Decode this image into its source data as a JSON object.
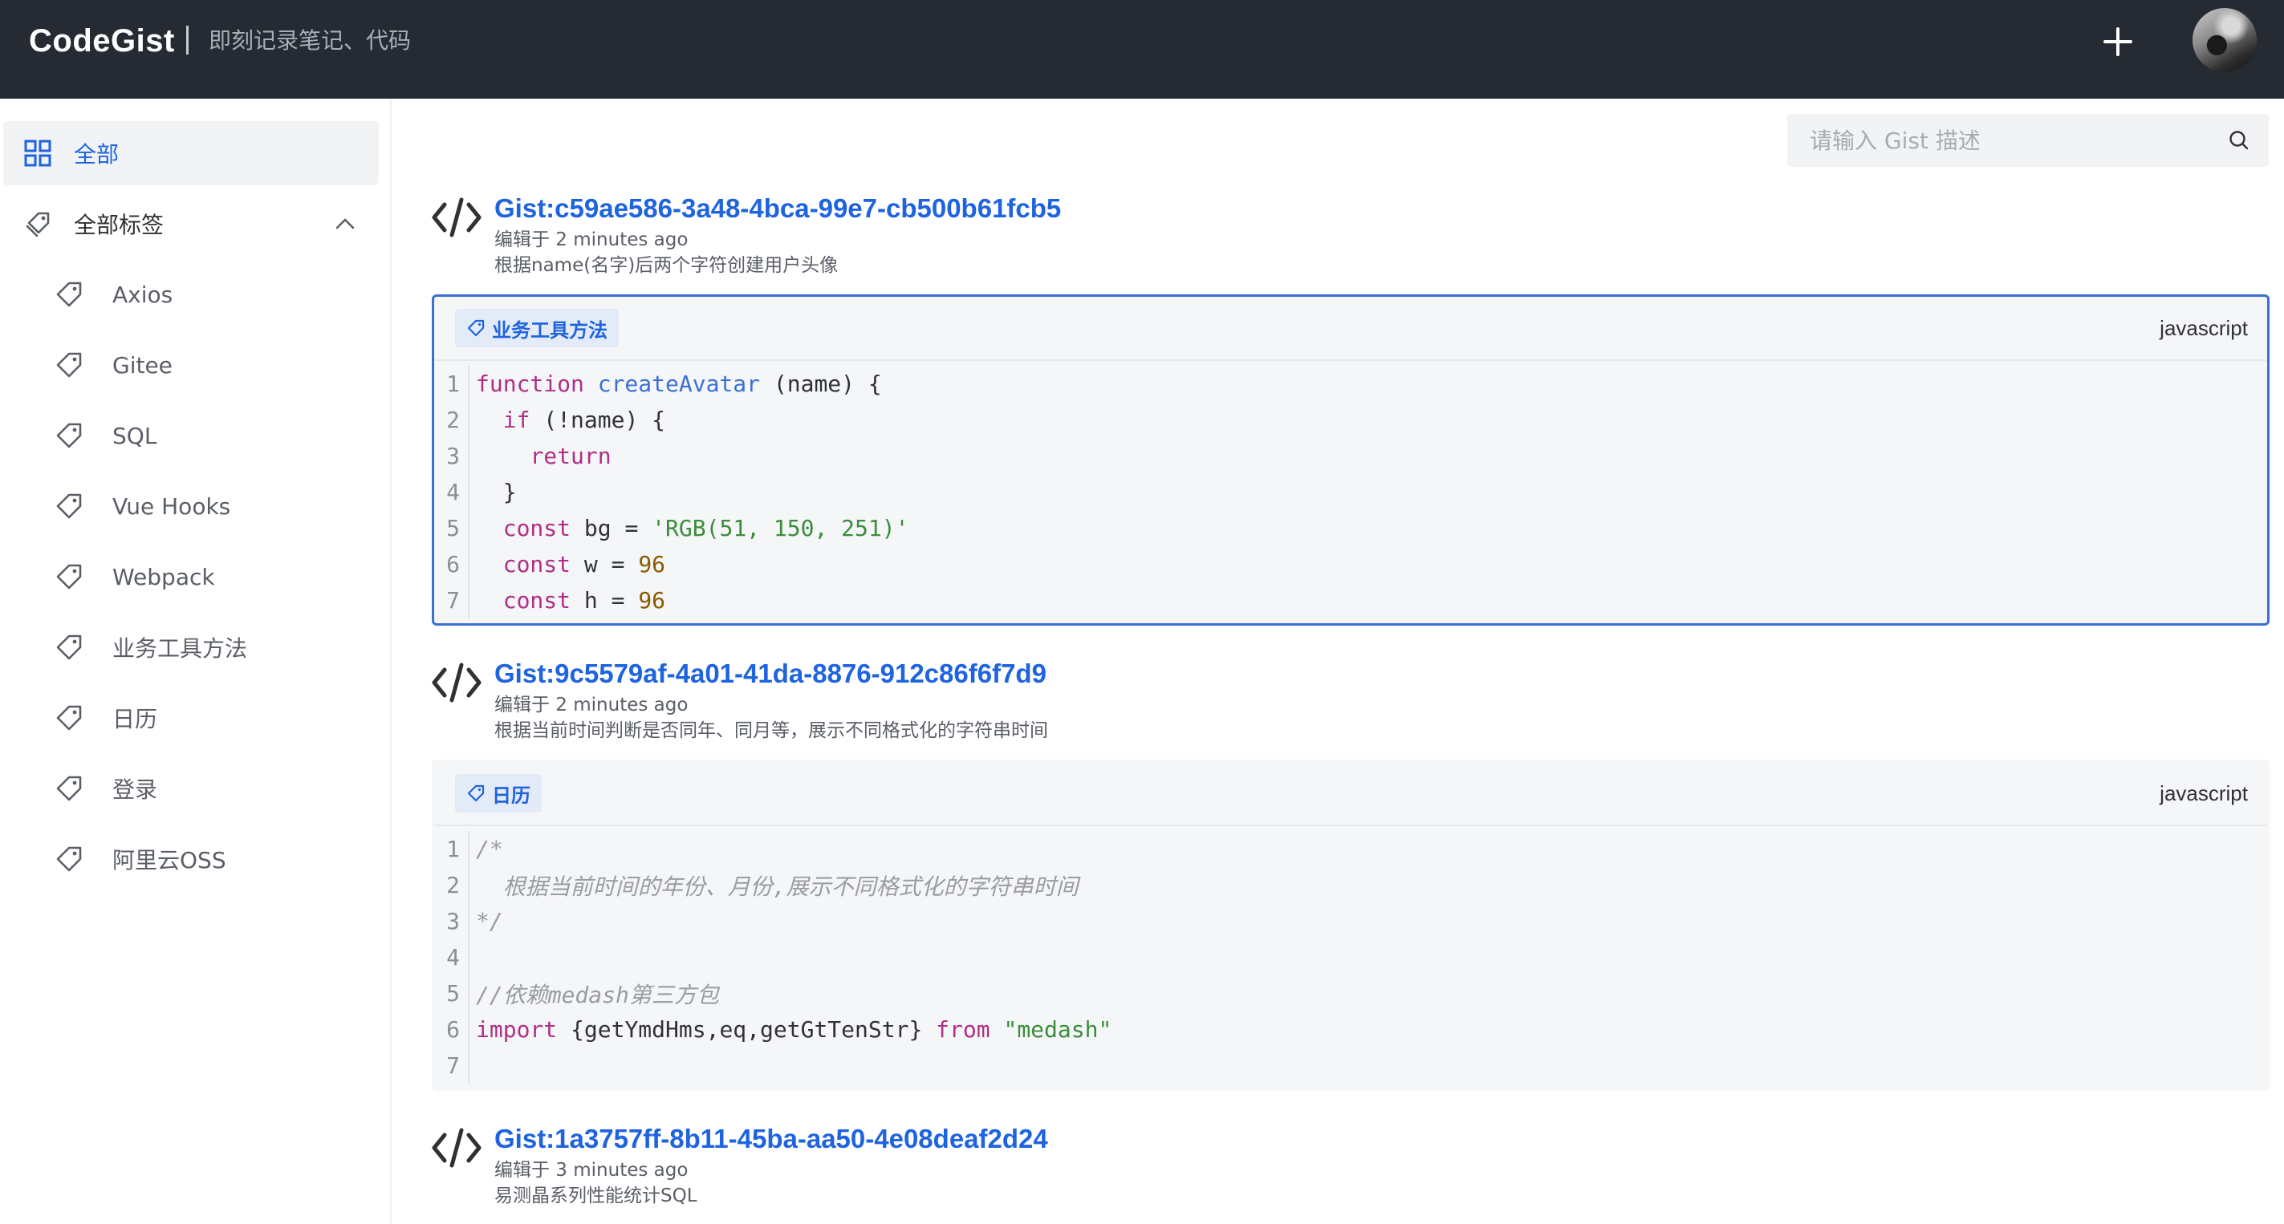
{
  "header": {
    "brand": "CodeGist",
    "subtitle": "即刻记录笔记、代码"
  },
  "sidebar": {
    "all_label": "全部",
    "tags_label": "全部标签",
    "tags": [
      "Axios",
      "Gitee",
      "SQL",
      "Vue Hooks",
      "Webpack",
      "业务工具方法",
      "日历",
      "登录",
      "阿里云OSS"
    ]
  },
  "search": {
    "placeholder": "请输入 Gist 描述"
  },
  "gists": [
    {
      "title": "Gist:c59ae586-3a48-4bca-99e7-cb500b61fcb5",
      "meta": "编辑于 2 minutes ago",
      "description": "根据name(名字)后两个字符创建用户头像",
      "tag": "业务工具方法",
      "language": "javascript",
      "lines": [
        {
          "n": "1",
          "code": "function createAvatar (name) {"
        },
        {
          "n": "2",
          "code": "  if (!name) {"
        },
        {
          "n": "3",
          "code": "    return"
        },
        {
          "n": "4",
          "code": "  }"
        },
        {
          "n": "5",
          "code": "  const bg = 'RGB(51, 150, 251)'"
        },
        {
          "n": "6",
          "code": "  const w = 96"
        },
        {
          "n": "7",
          "code": "  const h = 96"
        }
      ]
    },
    {
      "title": "Gist:9c5579af-4a01-41da-8876-912c86f6f7d9",
      "meta": "编辑于 2 minutes ago",
      "description": "根据当前时间判断是否同年、同月等，展示不同格式化的字符串时间",
      "tag": "日历",
      "language": "javascript",
      "lines": [
        {
          "n": "1",
          "code": "/*"
        },
        {
          "n": "2",
          "code": "  根据当前时间的年份、月份,展示不同格式化的字符串时间"
        },
        {
          "n": "3",
          "code": "*/"
        },
        {
          "n": "4",
          "code": ""
        },
        {
          "n": "5",
          "code": "//依赖medash第三方包"
        },
        {
          "n": "6",
          "code": "import {getYmdHms,eq,getGtTenStr} from \"medash\""
        },
        {
          "n": "7",
          "code": ""
        }
      ]
    },
    {
      "title": "Gist:1a3757ff-8b11-45ba-aa50-4e08deaf2d24",
      "meta": "编辑于 3 minutes ago",
      "description": "易测晶系列性能统计SQL"
    }
  ]
}
